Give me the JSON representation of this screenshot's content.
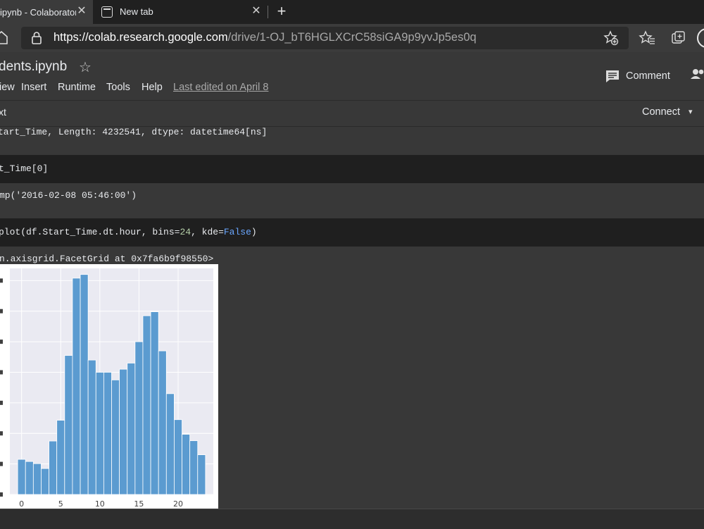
{
  "browser": {
    "tabs": [
      {
        "title": "ipynb - Colaboratory",
        "active": true
      },
      {
        "title": "New tab",
        "active": false
      }
    ],
    "new_tab_label": "+",
    "close_glyph": "✕",
    "url_host": "https://colab.research.google.com",
    "url_path": "/drive/1-OJ_bT6HGLXCrC58siGA9p9yvJp5es0q"
  },
  "colab": {
    "notebook_title": "dents.ipynb",
    "star_glyph": "☆",
    "menu": [
      "iew",
      "Insert",
      "Runtime",
      "Tools",
      "Help"
    ],
    "last_edited": "Last edited on April 8",
    "comment_label": "Comment",
    "bar_label": "xt",
    "connect_label": "Connect",
    "caret_glyph": "▾"
  },
  "cells": {
    "out1": "tart_Time, Length: 4232541, dtype: datetime64[ns]",
    "code2": "t_Time[0]",
    "out2": "mp('2016-02-08 05:46:00')",
    "code3_a": "plot(df.Start_Time.dt.hour, bins=",
    "code3_num": "24",
    "code3_b": ", kde=",
    "code3_kw": "False",
    "code3_c": ")",
    "out3": "n.axisgrid.FacetGrid at 0x7fa6b9f98550>"
  },
  "chart_data": {
    "type": "bar",
    "x": [
      0,
      1,
      2,
      3,
      4,
      5,
      6,
      7,
      8,
      9,
      10,
      11,
      12,
      13,
      14,
      15,
      16,
      17,
      18,
      19,
      20,
      21,
      22,
      23
    ],
    "values": [
      115000,
      108000,
      101000,
      85000,
      175000,
      243000,
      455000,
      708000,
      720000,
      440000,
      400000,
      400000,
      375000,
      410000,
      430000,
      500000,
      585000,
      598000,
      470000,
      330000,
      245000,
      197000,
      176000,
      130000
    ],
    "xticks": [
      "0",
      "5",
      "10",
      "15",
      "20"
    ],
    "xlim": [
      -1.5,
      24.5
    ],
    "ylim": [
      0,
      740000
    ],
    "grid": true,
    "bar_color": "#5b9bd0",
    "plot_background": "#eaeaf2"
  }
}
